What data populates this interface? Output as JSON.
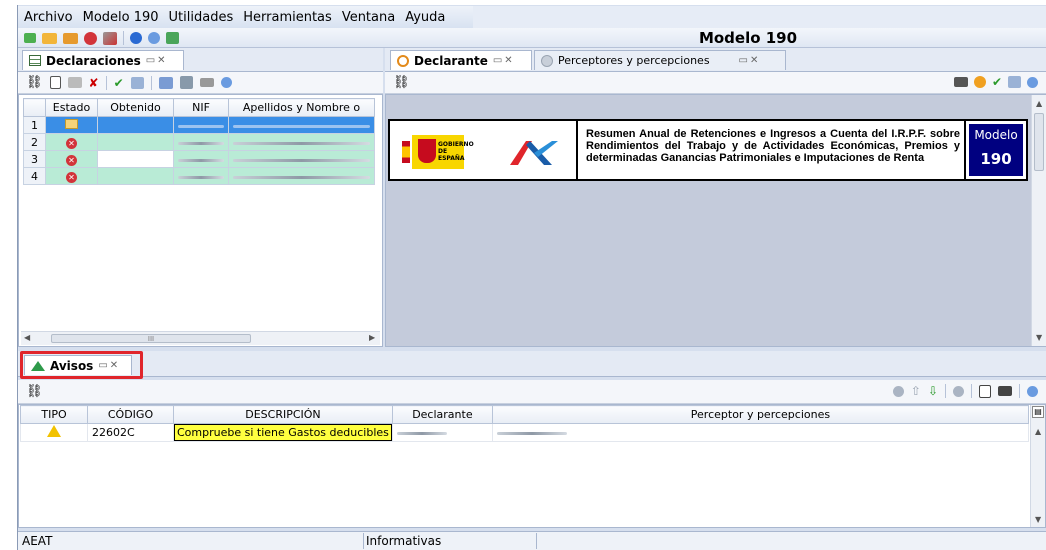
{
  "menu": [
    "Archivo",
    "Modelo 190",
    "Utilidades",
    "Herramientas",
    "Ventana",
    "Ayuda"
  ],
  "window_title": "Modelo 190",
  "left_tab": {
    "label": "Declaraciones"
  },
  "decl_table": {
    "columns": [
      "",
      "Estado",
      "Obtenido",
      "NIF",
      "Apellidos y Nombre o"
    ],
    "rows": [
      "1",
      "2",
      "3",
      "4"
    ]
  },
  "right_tabs": [
    {
      "label": "Declarante"
    },
    {
      "label": "Perceptores y percepciones"
    }
  ],
  "header_box": {
    "gov_line1": "GOBIERNO",
    "gov_line2": "DE ESPAÑA",
    "description": "Resumen Anual de Retenciones e Ingresos a Cuenta del I.R.P.F. sobre Rendimientos del Trabajo y de Actividades Económicas, Premios y determinadas Ganancias Patrimoniales e Imputaciones de Renta",
    "modelo_label": "Modelo",
    "modelo_number": "190"
  },
  "avisos_tab": {
    "label": "Avisos"
  },
  "avisos_table": {
    "columns": [
      "TIPO",
      "CÓDIGO",
      "DESCRIPCIÓN",
      "Declarante",
      "Perceptor y percepciones"
    ],
    "row": {
      "codigo": "22602C",
      "descripcion": "Compruebe si tiene Gastos deducibles"
    }
  },
  "scroll_label": "III",
  "status": {
    "left": "AEAT",
    "middle": "Informativas"
  },
  "colors": {
    "accent_blue": "#000080",
    "highlight_red": "#e0252b",
    "tooltip_yellow": "#ffff40"
  }
}
